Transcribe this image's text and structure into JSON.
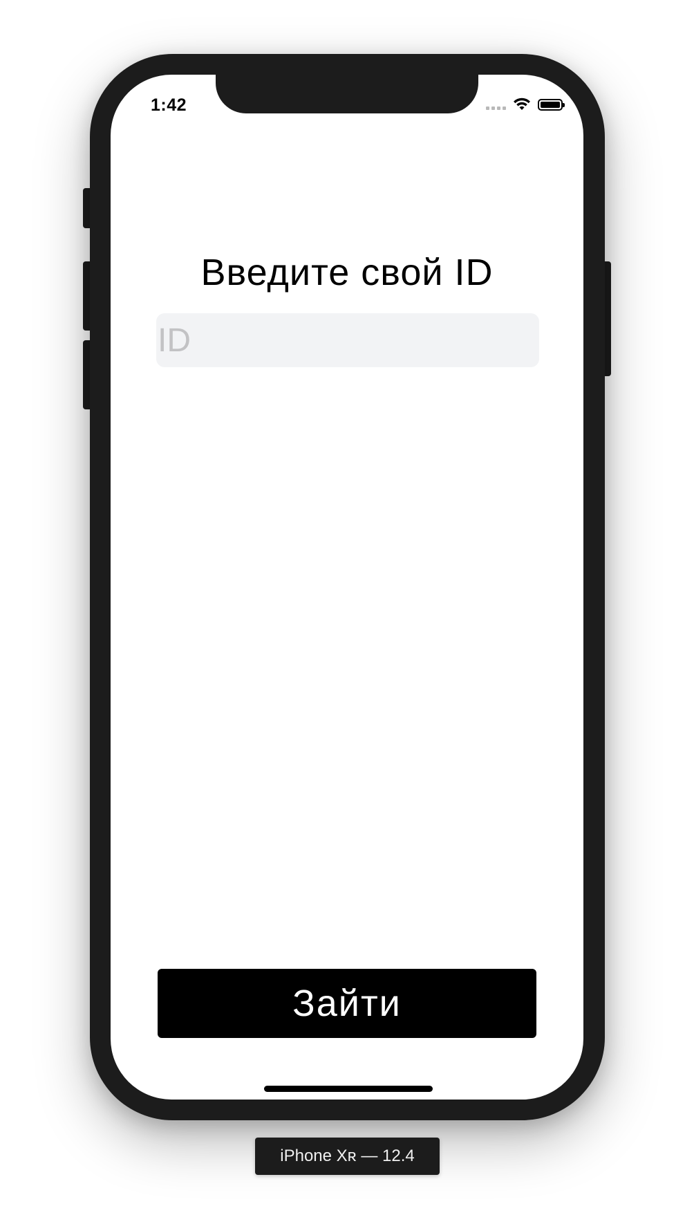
{
  "status_bar": {
    "time": "1:42",
    "icons": [
      "cellular-signal-icon",
      "wifi-icon",
      "battery-icon"
    ],
    "battery_level_fraction": 1.0
  },
  "login_screen": {
    "title": "Введите свой ID",
    "id_input": {
      "value": "",
      "placeholder": "ID"
    },
    "login_button_label": "Зайти"
  },
  "simulator": {
    "device_label": "iPhone Xʀ — 12.4"
  },
  "colors": {
    "phone_frame": "#1c1c1c",
    "input_background": "#f2f3f5",
    "placeholder": "#c2c2c4",
    "button_background": "#000000",
    "button_text": "#ffffff"
  }
}
